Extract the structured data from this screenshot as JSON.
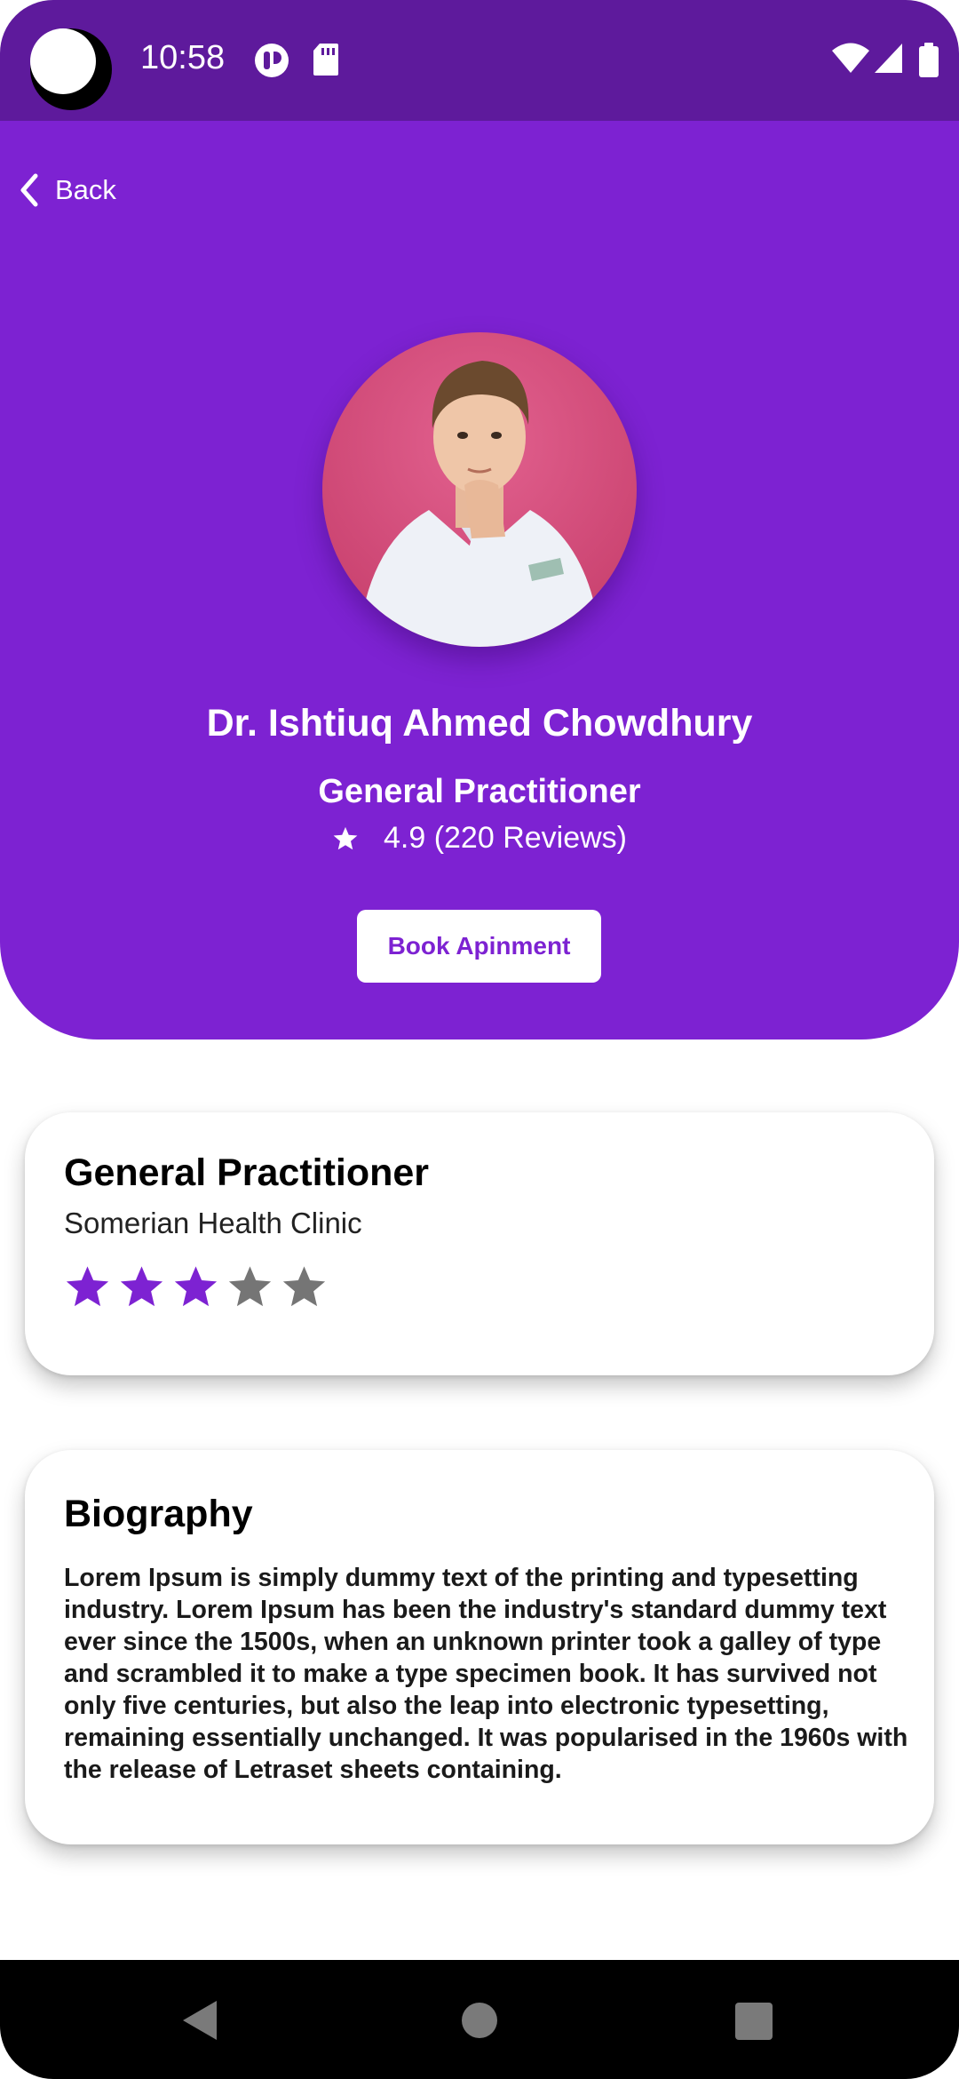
{
  "status_bar": {
    "time": "10:58",
    "icons": [
      "camera-cutout",
      "tcell-app-icon",
      "sd-card-icon",
      "wifi-icon",
      "cell-signal-icon",
      "battery-icon"
    ]
  },
  "header": {
    "back_label": "Back",
    "doctor_name": "Dr. Ishtiuq Ahmed Chowdhury",
    "specialty": "General Practitioner",
    "rating_text": "4.9 (220 Reviews)",
    "book_button_label": "Book Apinment",
    "background_color": "#7d22d2"
  },
  "practice_card": {
    "title": "General Practitioner",
    "clinic": "Somerian Health Clinic",
    "rating": 3,
    "rating_max": 5,
    "star_color_filled": "#7d22d2",
    "star_color_empty": "#757575"
  },
  "biography_card": {
    "title": "Biography",
    "text": "Lorem Ipsum is simply dummy text of the printing and typesetting industry. Lorem Ipsum has been the industry's standard dummy text ever since the 1500s, when an unknown printer took a galley of type and scrambled it to make a type specimen book. It has survived not only five centuries, but also the leap into electronic typesetting, remaining essentially unchanged. It was popularised in the 1960s with the release of Letraset sheets containing."
  },
  "nav_bar": {
    "buttons": [
      "back-nav-icon",
      "home-nav-icon",
      "recents-nav-icon"
    ]
  }
}
